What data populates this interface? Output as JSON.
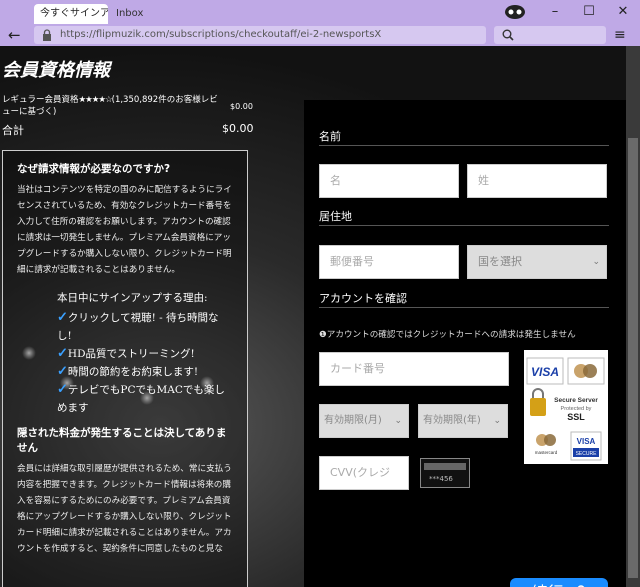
{
  "browser": {
    "tabs": [
      {
        "label": "今すぐサインアップ"
      },
      {
        "label": "Inbox"
      }
    ],
    "url": "https://flipmuzik.com/subscriptions/checkoutaff/ei-2-newsportsX",
    "window_controls": {
      "minimize": "–",
      "maximize": "☐",
      "close": "✕"
    }
  },
  "page": {
    "title": "会員資格情報",
    "plan": {
      "label_pre": "レギュラー会員資格",
      "stars": "★★★★☆",
      "label_post": "(1,350,892件のお客様レビューに基づく)",
      "price": "$0.00",
      "rating": 4
    },
    "total": {
      "label": "合計",
      "value": "$0.00"
    },
    "info": {
      "why_title": "なぜ請求情報が必要なのですか?",
      "why_text": "当社はコンテンツを特定の国のみに配信するようにライセンスされているため、有効なクレジットカード番号を入力して住所の確認をお願いします。アカウントの確認に請求は一切発生しません。プレミアム会員資格にアップグレードするか購入しない限り、クレジットカード明細に請求が記載されることはありません。",
      "reasons_title": "本日中にサインアップする理由:",
      "reasons": [
        "クリックして視聴! - 待ち時間なし!",
        "HD品質でストリーミング!",
        "時間の節約をお約束します!",
        "テレビでもPCでもMACでも楽しめます"
      ],
      "hidden_title": "隠された料金が発生することは決してありません",
      "hidden_text": "会員には詳細な取引履歴が提供されるため、常に支払う内容を把握できます。クレジットカード情報は将来の購入を容易にするためにのみ必要です。プレミアム会員資格にアップグレードするか購入しない限り、クレジットカード明細に請求が記載されることはありません。アカウントを作成すると、契約条件に同意したものと見な"
    }
  },
  "form": {
    "name_section": "名前",
    "first_name_placeholder": "名",
    "last_name_placeholder": "姓",
    "address_section": "居住地",
    "postal_placeholder": "郵便番号",
    "country_placeholder": "国を選択",
    "account_section": "アカウントを確認",
    "account_note": "アカウントの確認ではクレジットカードへの請求は発生しません",
    "card_placeholder": "カード番号",
    "exp_month_placeholder": "有効期限(月)",
    "exp_year_placeholder": "有効期限(年)",
    "cvv_placeholder": "CVV(クレジ",
    "cvv_sample": "***456",
    "badges": {
      "visa": "VISA",
      "secure_line1": "Secure Server",
      "secure_line2": "Protected by",
      "secure_line3": "SSL",
      "mastercard": "mastercard",
      "visa_secure": "VISA",
      "visa_secure_sub": "SECURE"
    },
    "continue_label": "続行"
  }
}
